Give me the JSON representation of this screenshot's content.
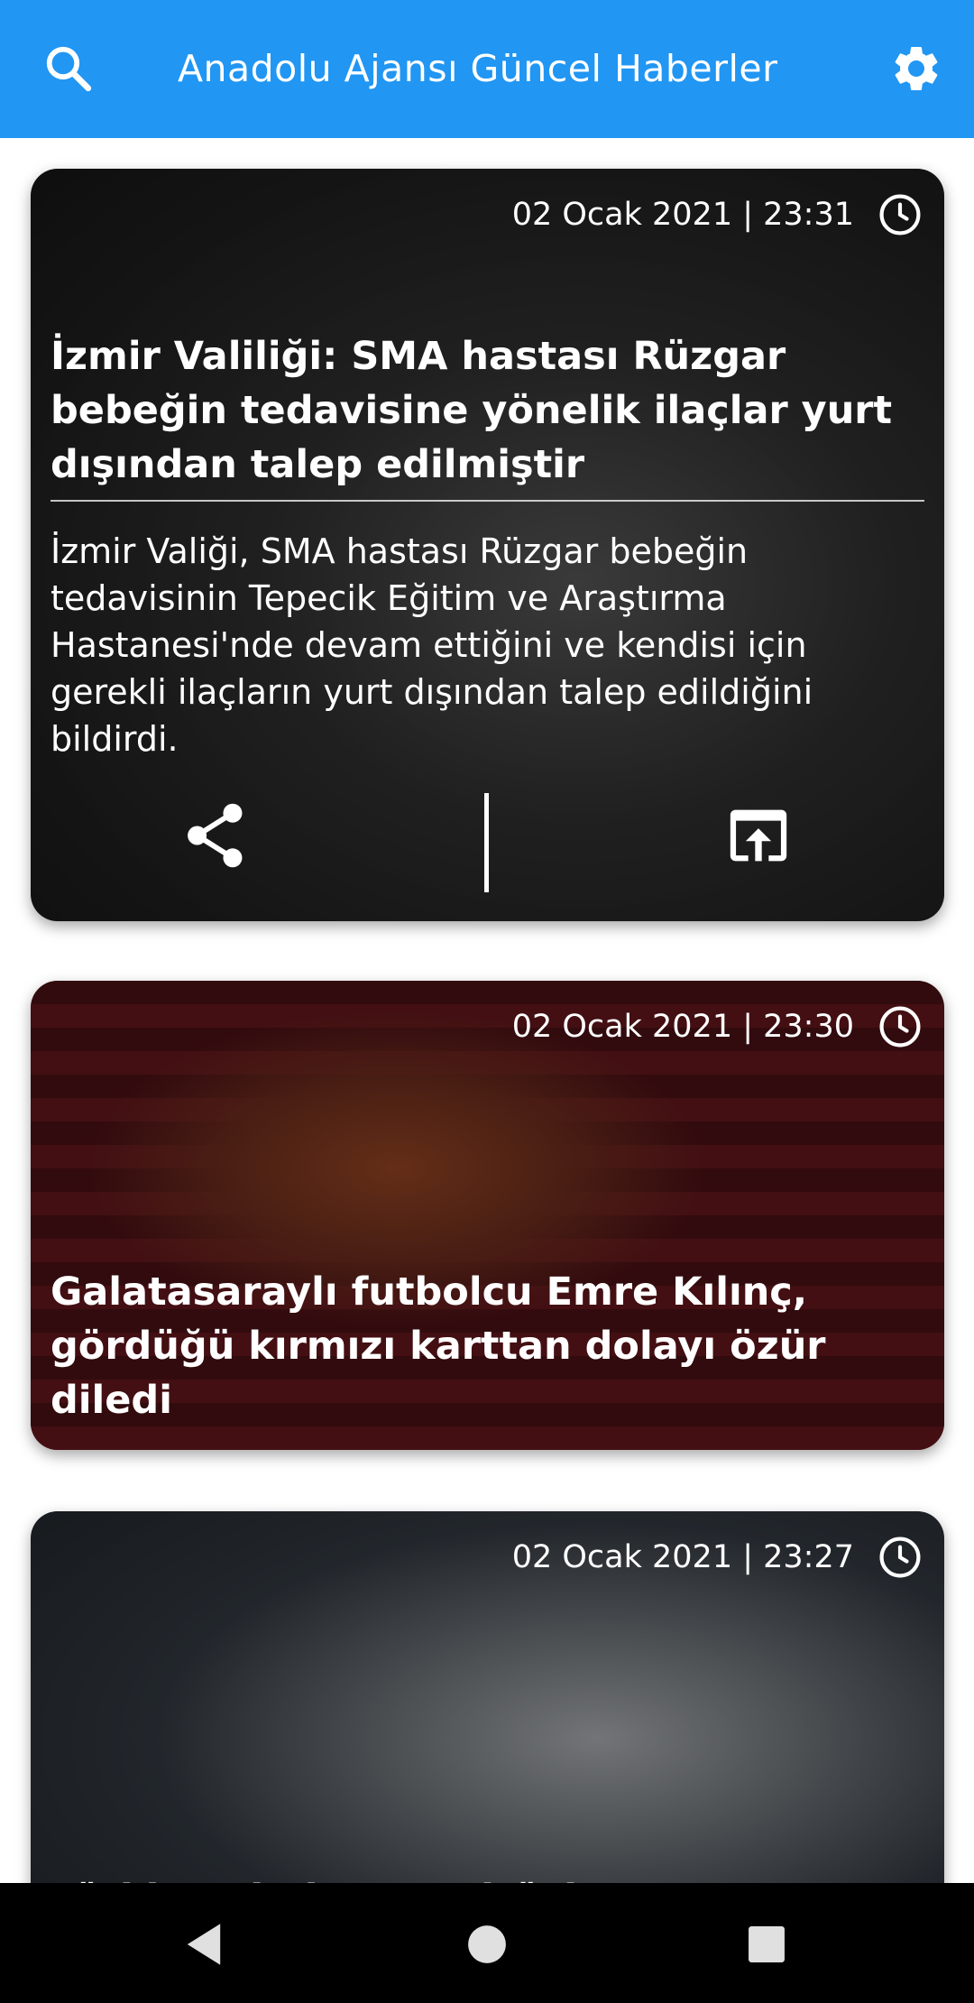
{
  "app_bar": {
    "title": "Anadolu Ajansı Güncel Haberler",
    "color": "#2196f3",
    "icons": [
      "search-icon",
      "settings-icon"
    ]
  },
  "news": [
    {
      "date": "02 Ocak 2021 | 23:31",
      "headline": "İzmir Valiliği: SMA hastası Rüzgar bebeğin tedavisine yönelik ilaçlar yurt dışından talep edilmiştir",
      "summary": "İzmir Valiği, SMA hastası Rüzgar bebeğin tedavisinin Tepecik Eğitim ve Araştırma Hastanesi'nde devam ettiğini ve kendisi için gerekli ilaçların yurt dışından talep edildiğini bildirdi.",
      "expanded": true,
      "actions": [
        "share-icon",
        "open-in-browser-icon"
      ]
    },
    {
      "date": "02 Ocak 2021 | 23:30",
      "headline": "Galatasaraylı futbolcu Emre Kılınç, gördüğü kırmızı karttan dolayı özür diledi",
      "expanded": false
    },
    {
      "date": "02 Ocak 2021 | 23:27",
      "headline": "Türkiye'nin koronavirüsle mücadelesinde",
      "expanded": false
    }
  ],
  "nav_bar": {
    "buttons": [
      "back-icon",
      "home-icon",
      "recents-icon"
    ]
  }
}
